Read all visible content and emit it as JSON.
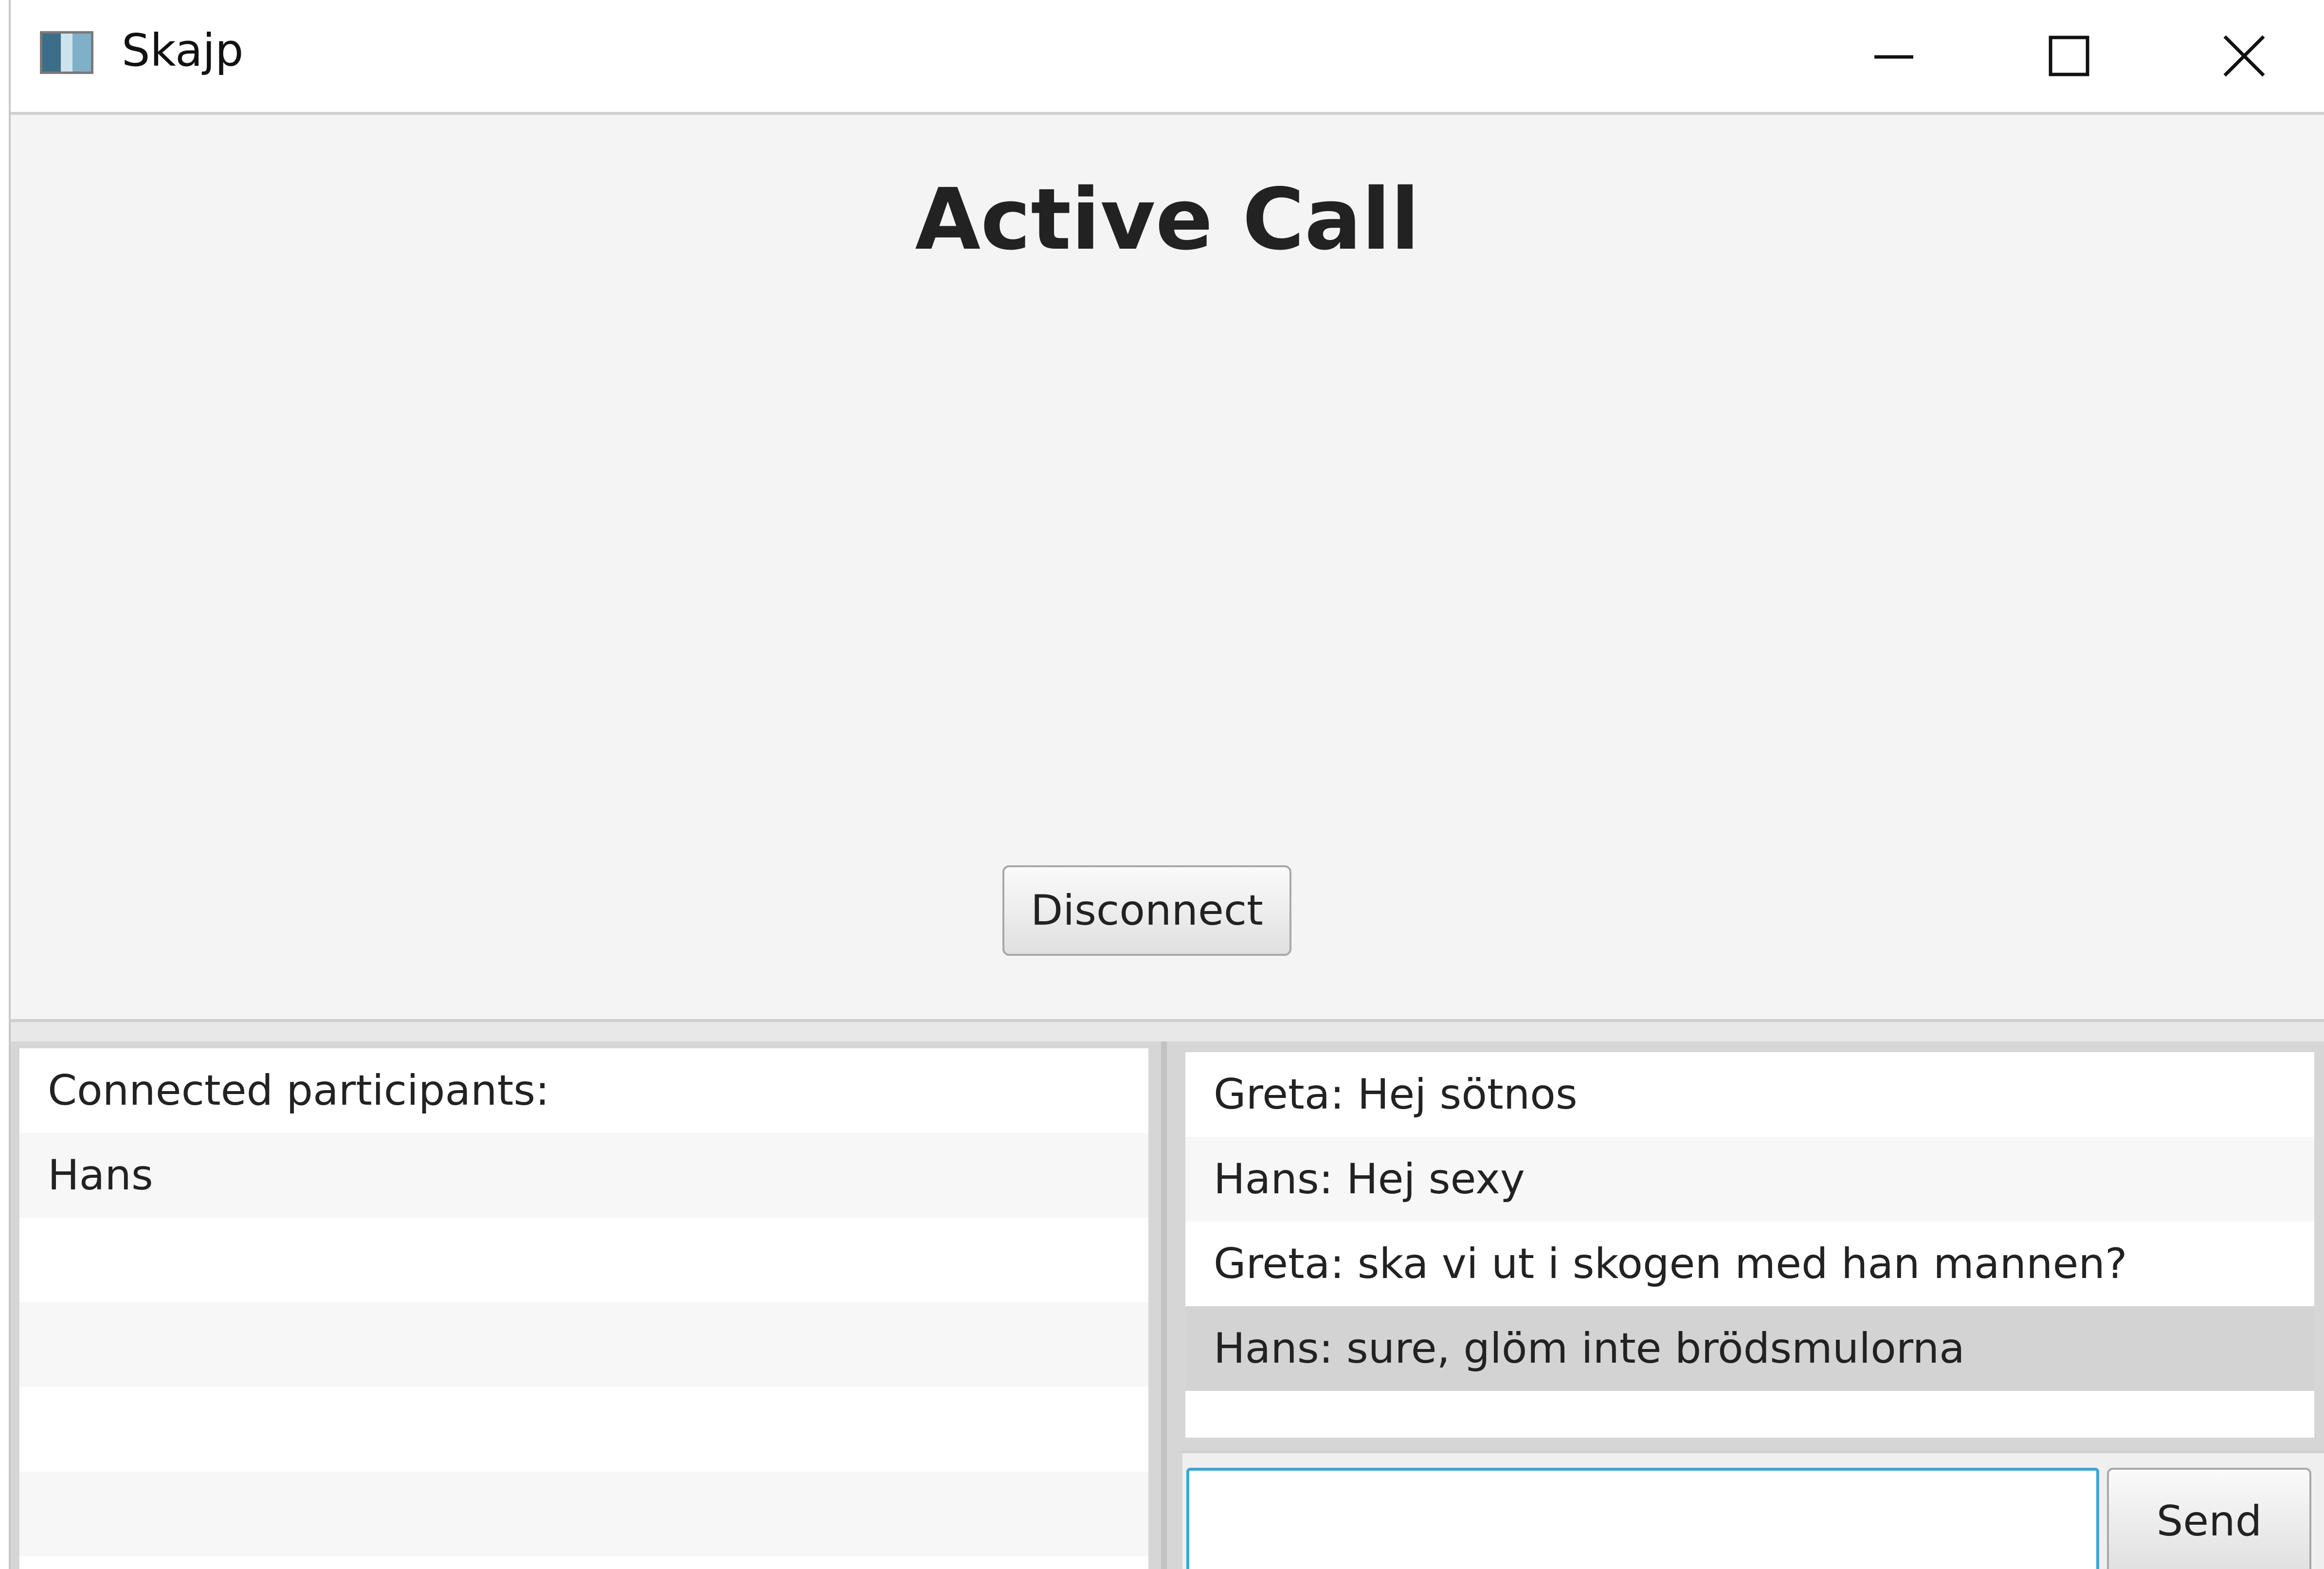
{
  "window": {
    "title": "Skajp",
    "icon": "app-window-icon",
    "controls": [
      "minimize-icon",
      "maximize-icon",
      "close-icon"
    ]
  },
  "call": {
    "heading": "Active Call",
    "disconnect_label": "Disconnect"
  },
  "participants": {
    "header": "Connected participants:",
    "items": [
      "Hans"
    ]
  },
  "chat": {
    "messages": [
      "Greta: Hej sötnos",
      "Hans: Hej sexy",
      "Greta: ska vi ut i skogen med han mannen?",
      "Hans: sure, glöm inte brödsmulorna"
    ],
    "selected_index": 3,
    "input_value": "",
    "send_label": "Send"
  },
  "colors": {
    "panel_bg": "#f4f4f4",
    "selection": "#d3d3d3",
    "focus_border": "#3aa6d8"
  }
}
